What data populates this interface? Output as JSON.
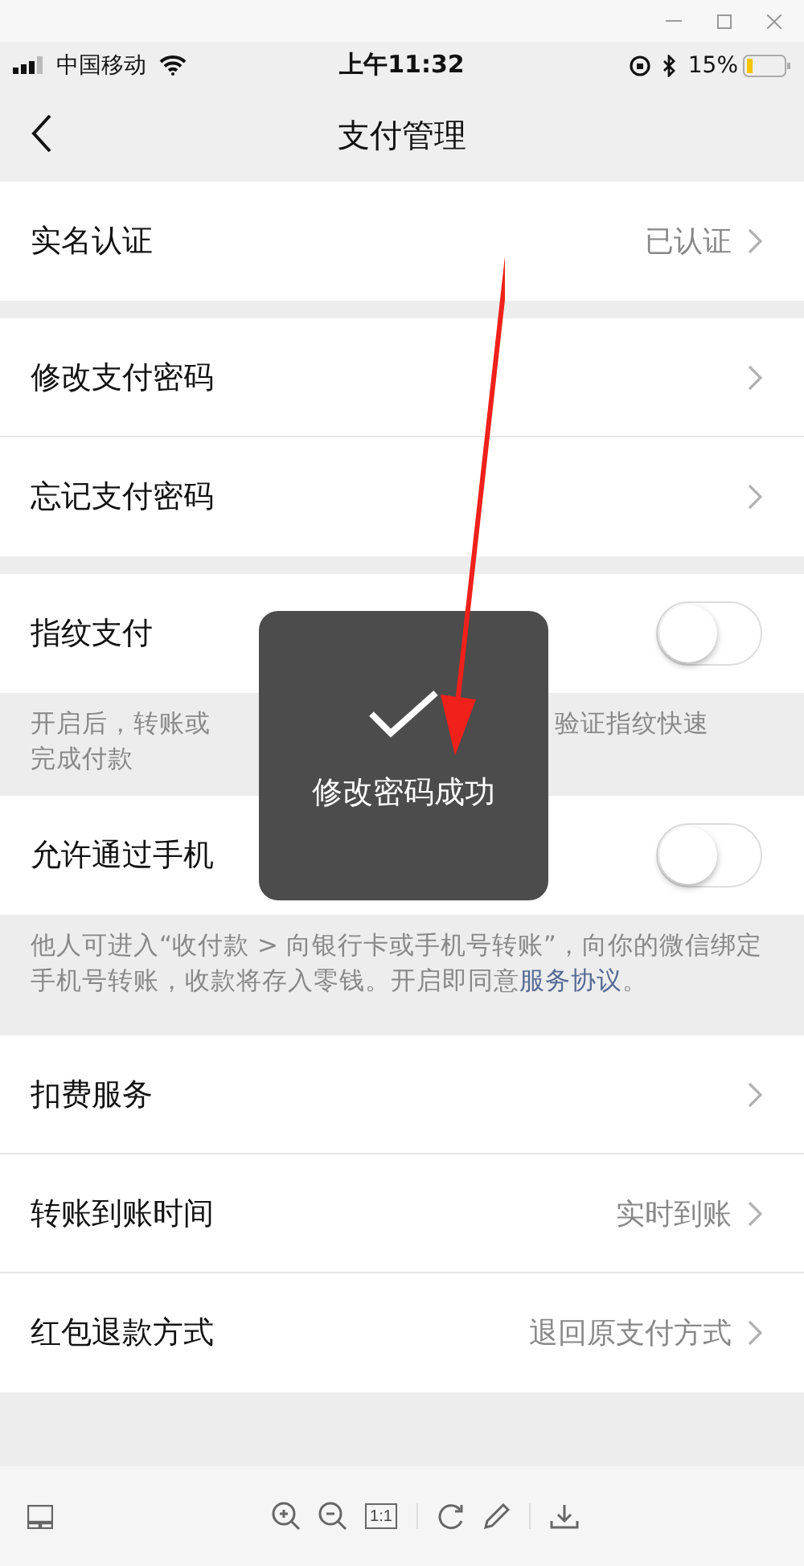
{
  "status_bar": {
    "carrier": "中国移动",
    "time": "上午11:32",
    "battery": "15%"
  },
  "nav": {
    "title": "支付管理"
  },
  "sections": [
    {
      "rows": [
        {
          "kind": "link",
          "label": "实名认证",
          "value": "已认证"
        }
      ]
    },
    {
      "rows": [
        {
          "kind": "link",
          "label": "修改支付密码"
        },
        {
          "kind": "link",
          "label": "忘记支付密码"
        }
      ]
    },
    {
      "rows": [
        {
          "kind": "toggle",
          "label": "指纹支付",
          "on": false
        },
        {
          "kind": "split_hint",
          "left": "开启后，转账或",
          "right": "验证指纹快速",
          "line2": "完成付款"
        },
        {
          "kind": "toggle",
          "label": "允许通过手机",
          "on": false
        },
        {
          "kind": "hint",
          "text": "他人可进入“收付款 > 向银行卡或手机号转账”，向你的微信绑定手机号转账，收款将存入零钱。开启即同意",
          "link": "服务协议",
          "tail": "。"
        }
      ]
    },
    {
      "rows": [
        {
          "kind": "link",
          "label": "扣费服务"
        },
        {
          "kind": "link",
          "label": "转账到账时间",
          "value": "实时到账"
        },
        {
          "kind": "link",
          "label": "红包退款方式",
          "value": "退回原支付方式"
        }
      ]
    }
  ],
  "toast": {
    "message": "修改密码成功"
  },
  "viewer_toolbar": {
    "actual_size": "1:1"
  }
}
